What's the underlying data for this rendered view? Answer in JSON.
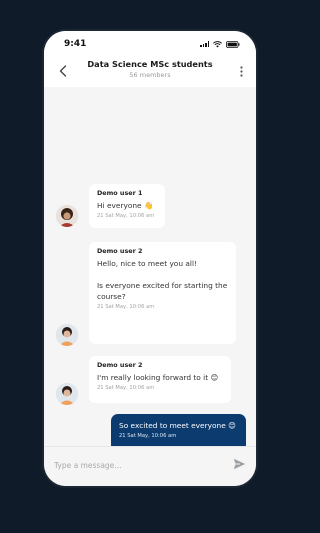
{
  "status_bar": {
    "time": "9:41"
  },
  "header": {
    "title": "Data Science MSc students",
    "subtitle": "56 members"
  },
  "messages": [
    {
      "sender": "Demo user 1",
      "text": "Hi everyone 👋",
      "time": "21 Sat May, 10:06 am"
    },
    {
      "sender": "Demo user 2",
      "text": "Hello, nice to meet you all!\n\nIs everyone excited for starting the course?",
      "time": "21 Sat May, 10:06 am"
    },
    {
      "sender": "Demo user 2",
      "text": "I'm really looking forward to it 😊",
      "time": "21 Sat May, 10:06 am"
    },
    {
      "sender": "",
      "text": "So excited to meet everyone 😊",
      "time": "21 Sat May, 10:06 am",
      "own": true
    }
  ],
  "composer": {
    "placeholder": "Type a message..."
  },
  "colors": {
    "own_bubble": "#0c3b6f",
    "background": "#0f1b28"
  },
  "icons": {
    "back": "chevron-left-icon",
    "more": "more-vertical-icon",
    "send": "send-icon"
  }
}
